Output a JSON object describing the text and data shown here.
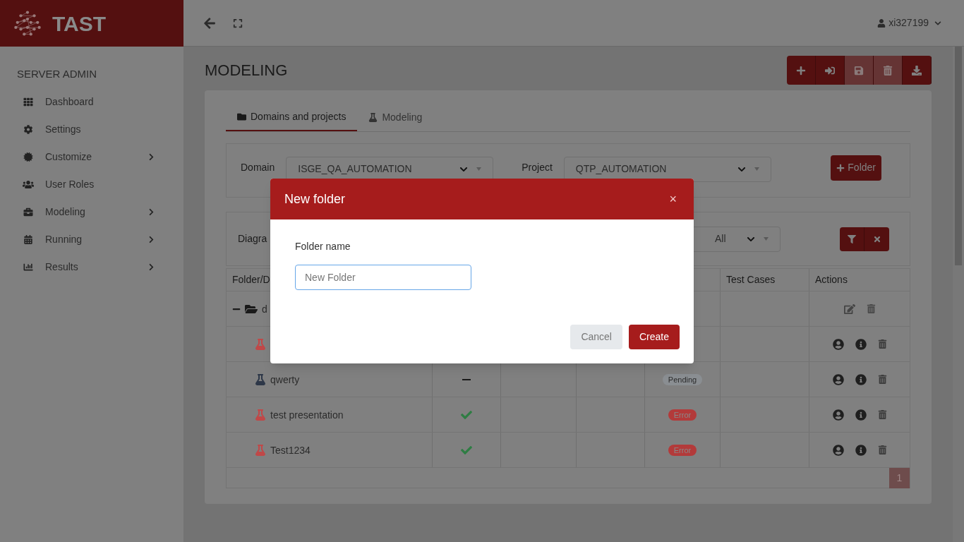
{
  "app": {
    "name": "TAST"
  },
  "topbar": {
    "user": "xi327199"
  },
  "sidebar": {
    "heading": "SERVER ADMIN",
    "items": [
      {
        "label": "Dashboard",
        "expandable": false
      },
      {
        "label": "Settings",
        "expandable": false
      },
      {
        "label": "Customize",
        "expandable": true
      },
      {
        "label": "User Roles",
        "expandable": false
      },
      {
        "label": "Modeling",
        "expandable": true
      },
      {
        "label": "Running",
        "expandable": true
      },
      {
        "label": "Results",
        "expandable": true
      }
    ]
  },
  "page": {
    "title": "MODELING"
  },
  "toolbar": [
    {
      "kind": "add",
      "disabled": false
    },
    {
      "kind": "import",
      "disabled": false
    },
    {
      "kind": "save",
      "disabled": true
    },
    {
      "kind": "delete",
      "disabled": true
    },
    {
      "kind": "download",
      "disabled": false
    }
  ],
  "tabs": [
    {
      "label": "Domains and projects",
      "selected": true
    },
    {
      "label": "Modeling",
      "selected": false
    }
  ],
  "selectors": {
    "domain_label": "Domain",
    "domain": "ISGE_QA_AUTOMATION",
    "project_label": "Project",
    "project": "QTP_AUTOMATION",
    "folder_button": "Folder"
  },
  "filters": {
    "label": "Diagra",
    "select": "All"
  },
  "table": {
    "columns": [
      "Folder/D",
      "",
      "",
      "",
      "",
      "Test Cases",
      "Actions"
    ],
    "rows": [
      {
        "kind": "folder",
        "expanded": true,
        "name": "d"
      },
      {
        "kind": "diagram",
        "color": "#c04848"
      },
      {
        "kind": "diagram",
        "color": "#2d3748",
        "name": "qwerty",
        "valid": false,
        "status": "Pending",
        "failed": false
      },
      {
        "kind": "diagram",
        "color": "#c04848",
        "name": "test presentation",
        "valid": true,
        "status": "Error",
        "failed": true
      },
      {
        "kind": "diagram",
        "color": "#c04848",
        "name": "Test1234",
        "valid": true,
        "status": "Error",
        "failed": true
      }
    ],
    "page": "1"
  },
  "dialog": {
    "title": "New folder",
    "close": "×",
    "field_label": "Folder name",
    "field_value": "New Folder",
    "cancel": "Cancel",
    "create": "Create"
  }
}
